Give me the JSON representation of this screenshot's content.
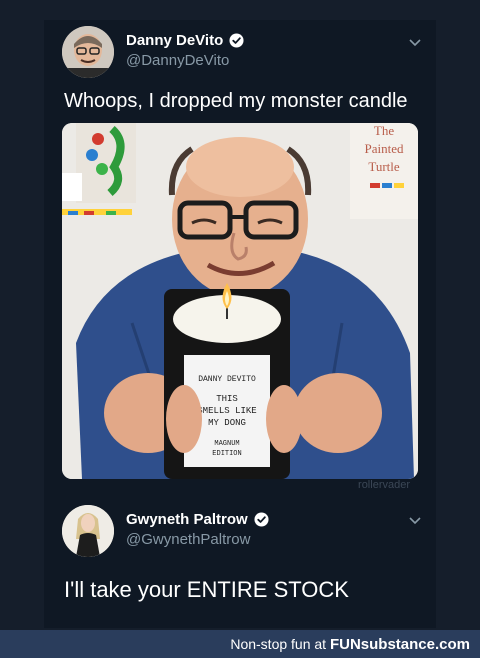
{
  "tweets": [
    {
      "author": "Danny DeVito",
      "handle": "@DannyDeVito",
      "text": "Whoops, I dropped my monster candle",
      "media": {
        "sign_lines": [
          "The",
          "Painted",
          "Turtle"
        ],
        "candle_label_lines": [
          "DANNY DEVITO",
          "THIS",
          "SMELLS LIKE",
          "MY DONG",
          "MAGNUM",
          "EDITION"
        ],
        "credit": "rollervader"
      }
    },
    {
      "author": "Gwyneth Paltrow",
      "handle": "@GwynethPaltrow",
      "text": "I'll take your ENTIRE STOCK"
    }
  ],
  "footer": {
    "prefix": "Non-stop fun at ",
    "brand": "FUNsubstance.com"
  },
  "colors": {
    "background": "#151e2b",
    "card": "#0f1824",
    "verified": "#ffffff",
    "handle": "#8899a6",
    "footer_bar": "#2a3d5c"
  }
}
